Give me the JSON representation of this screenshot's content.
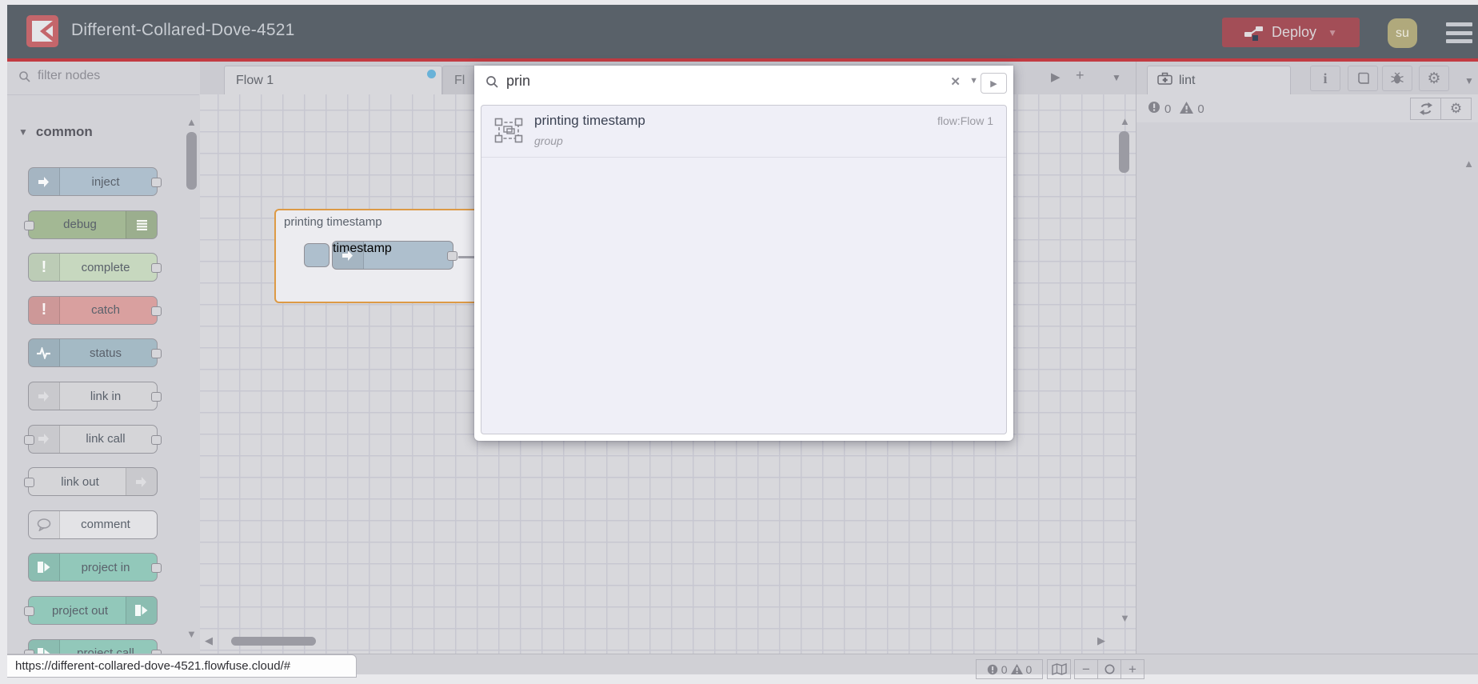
{
  "header": {
    "title": "Different-Collared-Dove-4521",
    "deploy_label": "Deploy",
    "avatar_text": "su",
    "logo_color": "#c4666b",
    "background": "#596169",
    "accent_line": "#c23b42"
  },
  "palette": {
    "filter_placeholder": "filter nodes",
    "category": "common",
    "nodes": [
      {
        "id": "inject",
        "label": "inject",
        "color": "#aebfcd",
        "icon": "inject",
        "icon_side": "left",
        "ports": "right"
      },
      {
        "id": "debug",
        "label": "debug",
        "color": "#a3b894",
        "icon": "debug",
        "icon_side": "right",
        "ports": "left"
      },
      {
        "id": "complete",
        "label": "complete",
        "color": "#c7d8bf",
        "icon": "exclaim",
        "icon_side": "left",
        "ports": "right"
      },
      {
        "id": "catch",
        "label": "catch",
        "color": "#d9a09f",
        "icon": "exclaim",
        "icon_side": "left",
        "ports": "right"
      },
      {
        "id": "status",
        "label": "status",
        "color": "#a4bac5",
        "icon": "status",
        "icon_side": "left",
        "ports": "right"
      },
      {
        "id": "link-in",
        "label": "link in",
        "color": "#d5d5d8",
        "icon": "link",
        "icon_side": "left",
        "ports": "right"
      },
      {
        "id": "link-call",
        "label": "link call",
        "color": "#d5d5d8",
        "icon": "link",
        "icon_side": "left",
        "ports": "both"
      },
      {
        "id": "link-out",
        "label": "link out",
        "color": "#d5d5d8",
        "icon": "link",
        "icon_side": "right",
        "ports": "left"
      },
      {
        "id": "comment",
        "label": "comment",
        "color": "#e3e3e6",
        "icon": "comment",
        "icon_side": "left",
        "ports": "none"
      },
      {
        "id": "project-in",
        "label": "project in",
        "color": "#92c8ba",
        "icon": "project",
        "icon_side": "left",
        "ports": "right"
      },
      {
        "id": "project-out",
        "label": "project out",
        "color": "#92c8ba",
        "icon": "project",
        "icon_side": "right",
        "ports": "left"
      },
      {
        "id": "project-call",
        "label": "project call",
        "color": "#92c8ba",
        "icon": "project",
        "icon_side": "left",
        "ports": "both"
      }
    ]
  },
  "tabs": {
    "flow1": "Flow 1",
    "flow2_visible": "Fl"
  },
  "canvas": {
    "group_label": "printing timestamp",
    "node_label": "timestamp",
    "group_border": "#dd9a45",
    "node_color": "#aebfcd"
  },
  "search": {
    "query": "prin",
    "result": {
      "title": "printing timestamp",
      "type": "group",
      "flow": "flow:Flow 1"
    }
  },
  "sidebar": {
    "tab_label": "lint",
    "counters": {
      "errors": "0",
      "warnings": "0"
    }
  },
  "footer": {
    "url": "https://different-collared-dove-4521.flowfuse.cloud/#",
    "counters": {
      "errors": "0",
      "warnings": "0"
    }
  }
}
